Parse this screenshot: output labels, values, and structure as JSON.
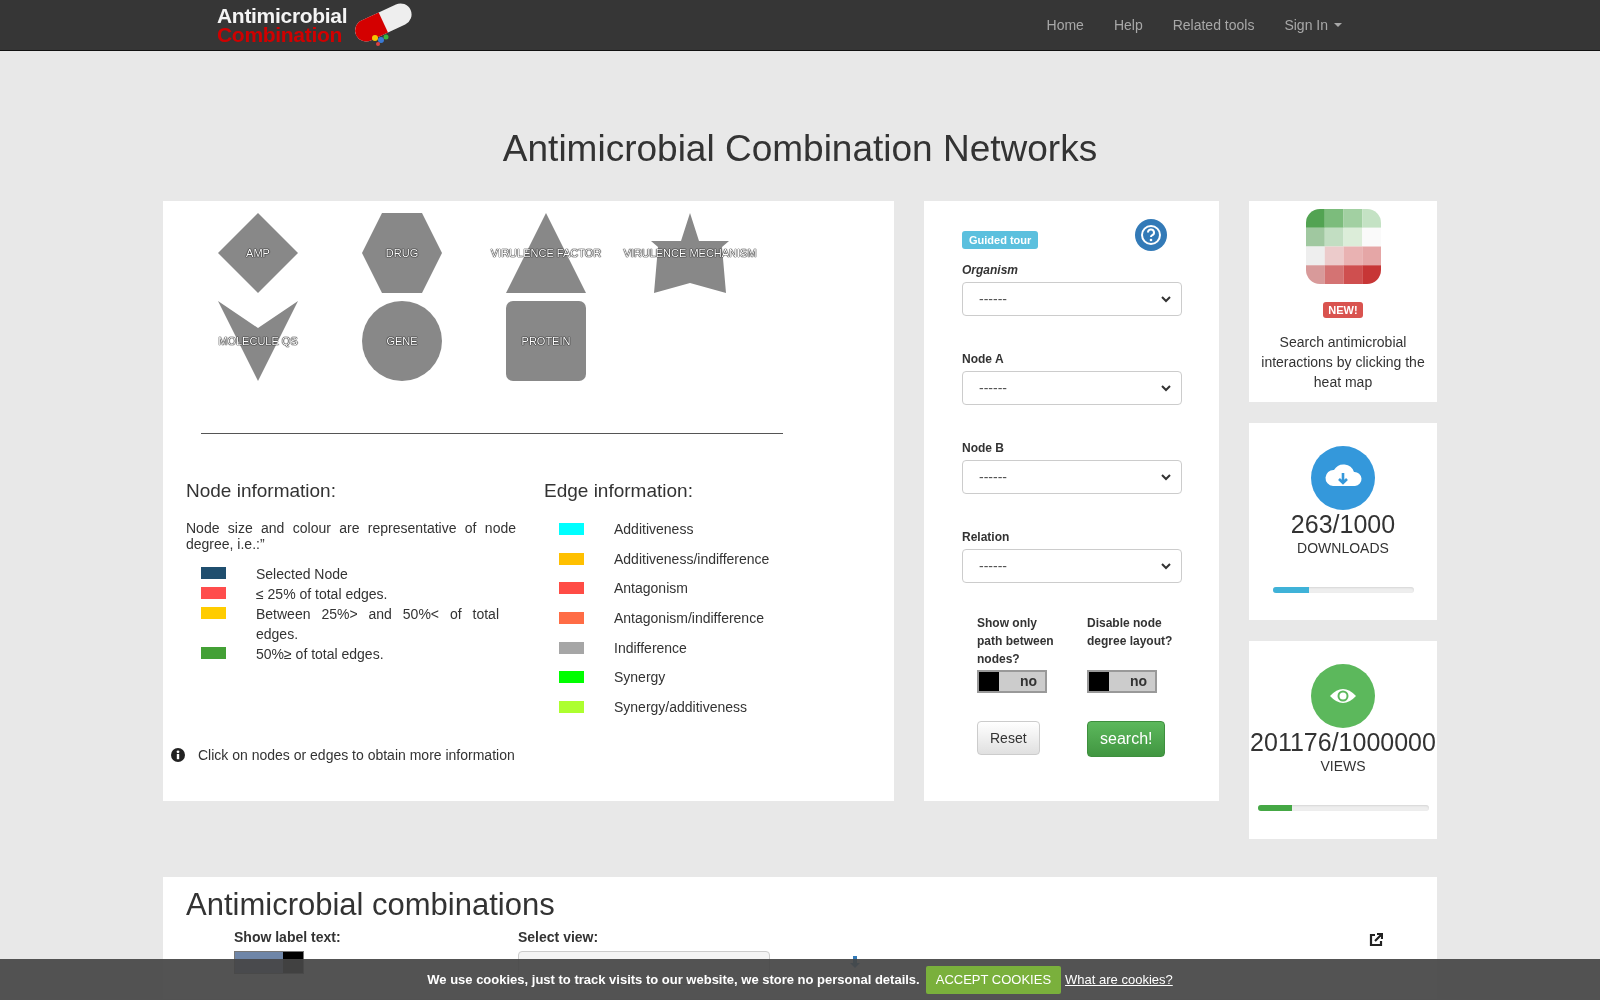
{
  "navbar": {
    "logo_line_1": "Antimicrobial",
    "logo_line_2": "Combination",
    "links": [
      {
        "label": "Home",
        "dropdown": false
      },
      {
        "label": "Help",
        "dropdown": false
      },
      {
        "label": "Related tools",
        "dropdown": false
      },
      {
        "label": "Sign In",
        "dropdown": true
      }
    ]
  },
  "title": "Antimicrobial Combination Networks",
  "node_types": [
    {
      "label": "AMP",
      "kind": "diamond"
    },
    {
      "label": "DRUG",
      "kind": "hexagon"
    },
    {
      "label": "VIRULENCE FACTOR",
      "kind": "triangle"
    },
    {
      "label": "VIRULENCE MECHANISM",
      "kind": "star"
    },
    {
      "label": "MOLECULE QS",
      "kind": "vee"
    },
    {
      "label": "GENE",
      "kind": "circle"
    },
    {
      "label": "PROTEIN",
      "kind": "square"
    }
  ],
  "node_information": {
    "heading": "Node information:",
    "description": "Node size and colour are representative of node degree, i.e.:”",
    "items": [
      {
        "label": "Selected Node",
        "color": "#1f4e6e"
      },
      {
        "label": "≤ 25% of total edges.",
        "color": "#ff4d4d"
      },
      {
        "label": "Between 25%> and 50%< of total edges.",
        "color": "#ffcc00"
      },
      {
        "label": "50%≥ of total edges.",
        "color": "#43a035"
      }
    ]
  },
  "edge_information": {
    "heading": "Edge information:",
    "items": [
      {
        "label": "Additiveness",
        "color": "#00ffff"
      },
      {
        "label": "Additiveness/indifference",
        "color": "#ffc000"
      },
      {
        "label": "Antagonism",
        "color": "#ff4c45"
      },
      {
        "label": "Antagonism/indifference",
        "color": "#ff6c45"
      },
      {
        "label": "Indifference",
        "color": "#a6a6a6"
      },
      {
        "label": "Synergy",
        "color": "#00ff00"
      },
      {
        "label": "Synergy/additiveness",
        "color": "#adff2f"
      }
    ]
  },
  "hint": "Click on nodes or edges to obtain more information",
  "search": {
    "guided_tour": "Guided tour",
    "fields": [
      {
        "label": "Organism",
        "italic": true,
        "value": "------"
      },
      {
        "label": "Node A",
        "italic": false,
        "value": "------"
      },
      {
        "label": "Node B",
        "italic": false,
        "value": "------"
      },
      {
        "label": "Relation",
        "italic": false,
        "value": "------"
      }
    ],
    "toggles": [
      {
        "label": "Show only path between nodes?",
        "on": false,
        "state_text": "no"
      },
      {
        "label": "Disable node degree layout?",
        "on": false,
        "state_text": "no"
      }
    ],
    "buttons": [
      {
        "label": "Reset",
        "kind": "default"
      },
      {
        "label": "search!",
        "kind": "primary"
      }
    ]
  },
  "heatmap_card": {
    "badge": "NEW!",
    "text": "Search antimicrobial interactions by clicking the heat map"
  },
  "stats": [
    {
      "kind": "downloads",
      "value": "263/1000",
      "label": "DOWNLOADS",
      "level": 0.26
    },
    {
      "kind": "views",
      "value": "201176/1000000",
      "label": "VIEWS",
      "level": 0.2
    }
  ],
  "combinations": {
    "heading": "Antimicrobial combinations",
    "show_label_text": "Show label text:",
    "label_toggle_on": true,
    "select_view": "Select view:"
  },
  "cookie_bar": {
    "message": "We use cookies, just to track visits to our website, we store no personal details.",
    "accept": "ACCEPT COOKIES",
    "link": "What are cookies?"
  }
}
